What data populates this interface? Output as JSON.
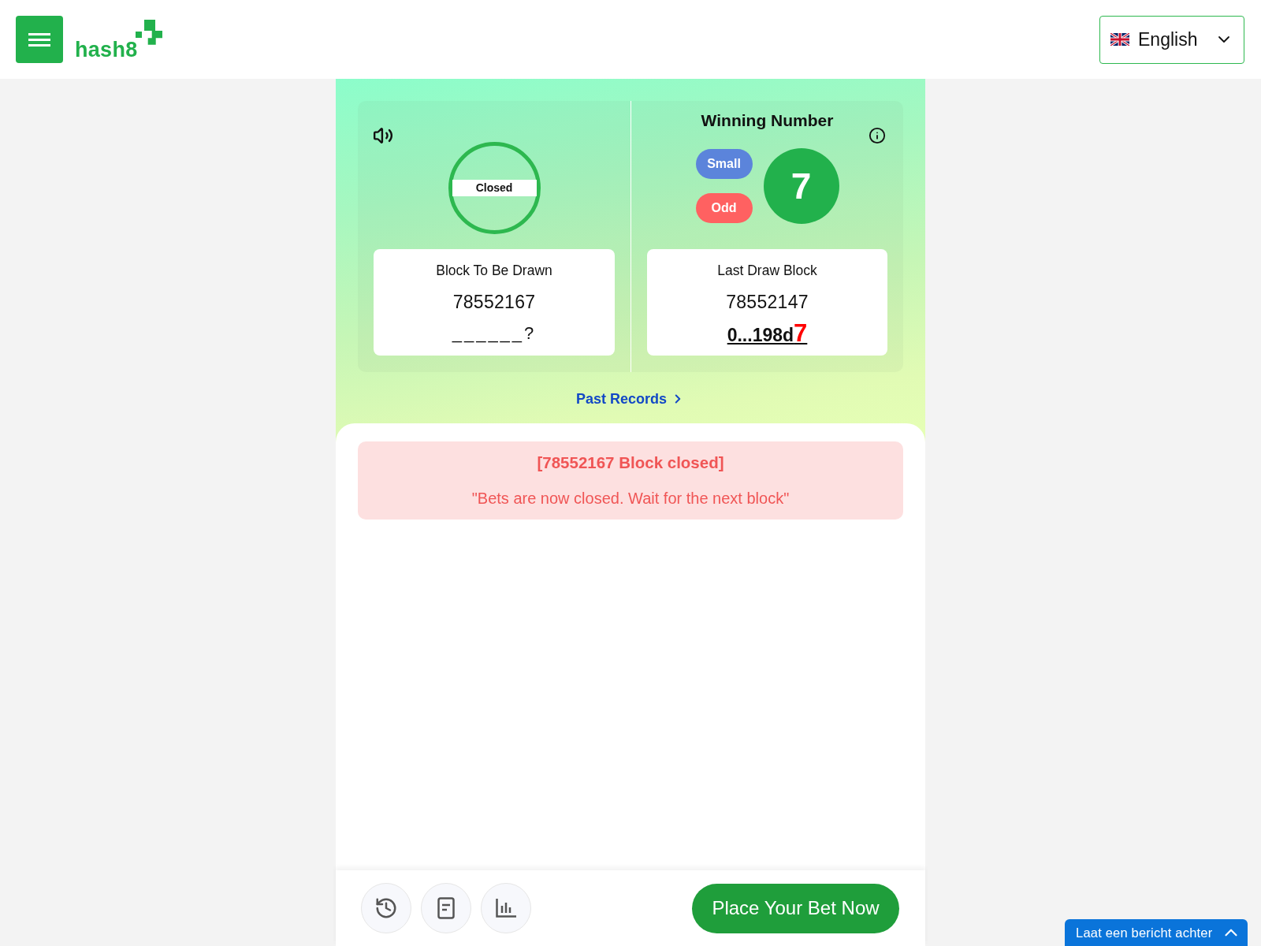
{
  "header": {
    "logo": "hash8",
    "language": "English"
  },
  "draw": {
    "status": "Closed",
    "upcoming": {
      "title": "Block To Be Drawn",
      "block": "78552167",
      "hash": "______?"
    },
    "winning": {
      "title": "Winning Number",
      "number": "7",
      "tags": [
        {
          "label": "Small",
          "color": "#5b84db"
        },
        {
          "label": "Odd",
          "color": "#ff6161"
        }
      ]
    },
    "last": {
      "title": "Last Draw Block",
      "block": "78552147",
      "hash": "0...198d",
      "hash_highlight": "7"
    }
  },
  "past_records": "Past Records",
  "alert": {
    "title": "[78552167 Block closed]",
    "message": "\"Bets are now closed. Wait for the next block\""
  },
  "bet_button": "Place Your Bet Now",
  "chat": "Laat een bericht achter"
}
